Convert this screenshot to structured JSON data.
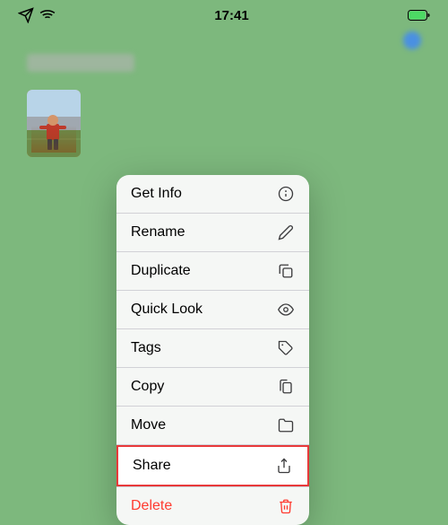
{
  "statusBar": {
    "time": "17:41",
    "icons": {
      "airplane": "✈",
      "wifi": "wifi-icon",
      "battery": "battery-icon"
    }
  },
  "contextMenu": {
    "items": [
      {
        "id": "get-info",
        "label": "Get Info",
        "icon": "info"
      },
      {
        "id": "rename",
        "label": "Rename",
        "icon": "pencil"
      },
      {
        "id": "duplicate",
        "label": "Duplicate",
        "icon": "duplicate"
      },
      {
        "id": "quick-look",
        "label": "Quick Look",
        "icon": "eye"
      },
      {
        "id": "tags",
        "label": "Tags",
        "icon": "tag"
      },
      {
        "id": "copy",
        "label": "Copy",
        "icon": "copy"
      },
      {
        "id": "move",
        "label": "Move",
        "icon": "folder"
      },
      {
        "id": "share",
        "label": "Share",
        "icon": "share",
        "highlighted": true
      },
      {
        "id": "delete",
        "label": "Delete",
        "icon": "trash",
        "isDestructive": true
      }
    ]
  }
}
